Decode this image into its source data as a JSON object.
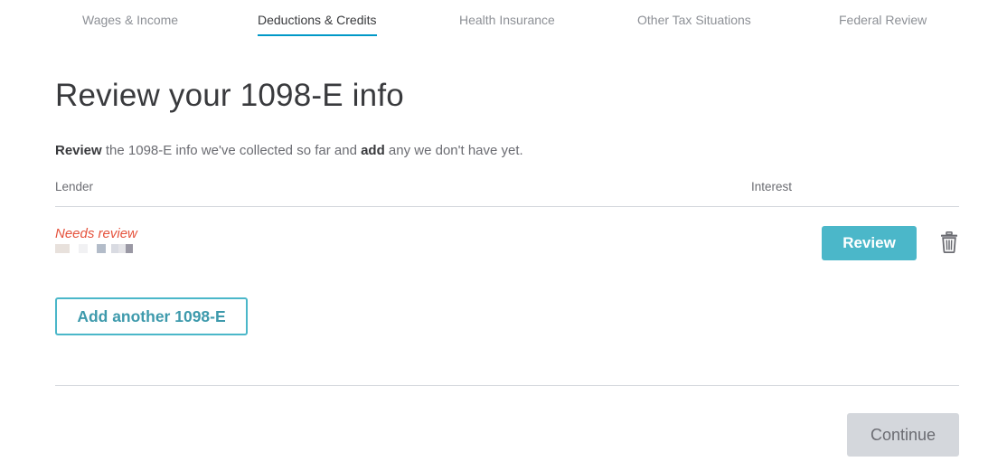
{
  "tabs": [
    {
      "label": "Wages & Income",
      "active": false
    },
    {
      "label": "Deductions & Credits",
      "active": true
    },
    {
      "label": "Health Insurance",
      "active": false
    },
    {
      "label": "Other Tax Situations",
      "active": false
    },
    {
      "label": "Federal Review",
      "active": false
    }
  ],
  "page": {
    "title": "Review your 1098-E info",
    "intro_strong_1": "Review",
    "intro_text_1": " the 1098-E info we've collected so far and ",
    "intro_strong_2": "add",
    "intro_text_2": " any we don't have yet."
  },
  "table": {
    "columns": {
      "lender": "Lender",
      "interest": "Interest"
    },
    "rows": [
      {
        "status": "Needs review",
        "review_label": "Review",
        "delete_icon": "trash-icon"
      }
    ]
  },
  "actions": {
    "add_label": "Add another 1098-E",
    "continue_label": "Continue"
  },
  "colors": {
    "accent": "#4bb7c9",
    "active_tab_underline": "#0098c7",
    "warning": "#e5523c",
    "disabled": "#d4d7dc"
  }
}
